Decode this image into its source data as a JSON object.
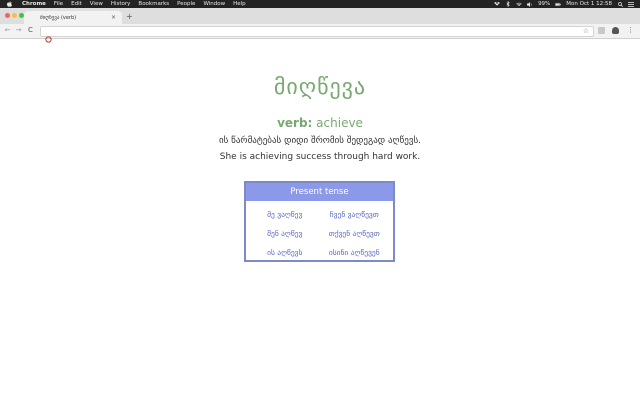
{
  "menubar": {
    "app_name": "Chrome",
    "items": [
      "File",
      "Edit",
      "View",
      "History",
      "Bookmarks",
      "People",
      "Window",
      "Help"
    ],
    "battery": "99%",
    "clock": "Mon Oct 1  12:58"
  },
  "tab": {
    "title": "მიღწევა (verb)",
    "close": "×"
  },
  "newtab": "+",
  "toolbar": {
    "back": "←",
    "forward": "→",
    "reload": "C",
    "url": "",
    "star": "☆",
    "menu": "⋮"
  },
  "page": {
    "word": "მიღწევა",
    "pos_label": "verb:",
    "translation": "achieve",
    "example_ka": "ის წარმატებას დიდი შრომის შედეგად აღწევს.",
    "example_en": "She is achieving success through hard work.",
    "conjugation": {
      "header": "Present tense",
      "rows": [
        [
          "მე ვაღწევ",
          "ჩვენ ვაღწევთ"
        ],
        [
          "შენ აღწევ",
          "თქვენ აღწევთ"
        ],
        [
          "ის აღწევს",
          "ისინი აღწევენ"
        ]
      ]
    }
  },
  "colors": {
    "accent_green": "#7aa873",
    "table_header": "#8c99e8",
    "table_border": "#7c8ac8",
    "table_text": "#5a68c0"
  }
}
